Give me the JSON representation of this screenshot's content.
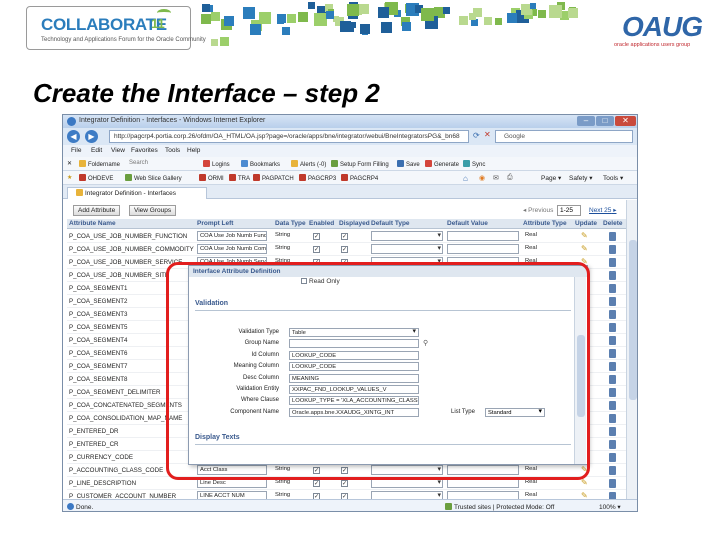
{
  "slide": {
    "collab_logo_word": "COLLABORATE",
    "collab_logo_num": "11",
    "collab_logo_tagline": "Technology and Applications Forum for the Oracle Community",
    "oaug_logo_word": "OAUG",
    "oaug_tagline": "oracle applications users group",
    "title": "Create the Interface – step 2"
  },
  "browser": {
    "window_title": "Integrator Definition - Interfaces - Windows Internet Explorer",
    "url": "http://pagcrp4.portia.corp.26/ofdm/OA_HTML/OA.jsp?page=/oracle/apps/bne/integrator/webui/BneIntegratorsPG&_bn68",
    "search_engine": "Google",
    "menu": [
      "File",
      "Edit",
      "View",
      "Favorites",
      "Tools",
      "Help"
    ],
    "favorites_bar": [
      "Foldername",
      "Search",
      "Logins",
      "Bookmarks",
      "Alerts (-0)",
      "Setup Form Filling",
      "Save",
      "Generate",
      "Sync"
    ],
    "links_bar": [
      "OHDEVE",
      "Web Slice Gallery",
      "ORMI",
      "TRA",
      "PAGPATCH",
      "PAGCRP3",
      "PAGCRP4"
    ],
    "tab_label": "Integrator Definition - Interfaces",
    "status_left": "Done.",
    "status_zone": "Trusted sites | Protected Mode: Off",
    "status_zoom": "100%"
  },
  "page": {
    "buttons": {
      "add_attribute": "Add Attribute",
      "view_groups": "View Groups"
    },
    "pager": {
      "previous": "Previous",
      "range": "1-25",
      "next": "Next 25"
    },
    "columns": [
      "Attribute Name",
      "Prompt Left",
      "Data Type",
      "Enabled",
      "Displayed",
      "Default Type",
      "Default Value",
      "Attribute Type",
      "Update",
      "Delete"
    ],
    "rows": [
      {
        "name": "P_COA_USE_JOB_NUMBER_FUNCTION",
        "prompt": "COA Use Job Numb Func",
        "type": "String",
        "attr_type": "Real"
      },
      {
        "name": "P_COA_USE_JOB_NUMBER_COMMODITY",
        "prompt": "COA Use Job Numb Comm",
        "type": "String",
        "attr_type": "Real"
      },
      {
        "name": "P_COA_USE_JOB_NUMBER_SERVICE",
        "prompt": "COA Use Job Numb Serv",
        "type": "String",
        "attr_type": "Real"
      },
      {
        "name": "P_COA_USE_JOB_NUMBER_SITE",
        "prompt": "",
        "type": "",
        "attr_type": ""
      },
      {
        "name": "P_COA_SEGMENT1",
        "prompt": "",
        "type": "",
        "attr_type": ""
      },
      {
        "name": "P_COA_SEGMENT2",
        "prompt": "",
        "type": "",
        "attr_type": ""
      },
      {
        "name": "P_COA_SEGMENT3",
        "prompt": "",
        "type": "",
        "attr_type": ""
      },
      {
        "name": "P_COA_SEGMENT5",
        "prompt": "",
        "type": "",
        "attr_type": ""
      },
      {
        "name": "P_COA_SEGMENT4",
        "prompt": "",
        "type": "",
        "attr_type": ""
      },
      {
        "name": "P_COA_SEGMENT6",
        "prompt": "",
        "type": "",
        "attr_type": ""
      },
      {
        "name": "P_COA_SEGMENT7",
        "prompt": "",
        "type": "",
        "attr_type": ""
      },
      {
        "name": "P_COA_SEGMENT8",
        "prompt": "",
        "type": "",
        "attr_type": ""
      },
      {
        "name": "P_COA_SEGMENT_DELIMITER",
        "prompt": "",
        "type": "",
        "attr_type": ""
      },
      {
        "name": "P_COA_CONCATENATED_SEGMENTS",
        "prompt": "",
        "type": "",
        "attr_type": ""
      },
      {
        "name": "P_COA_CONSOLIDATION_MAP_NAME",
        "prompt": "",
        "type": "",
        "attr_type": ""
      },
      {
        "name": "P_ENTERED_DR",
        "prompt": "",
        "type": "",
        "attr_type": ""
      },
      {
        "name": "P_ENTERED_CR",
        "prompt": "",
        "type": "",
        "attr_type": ""
      },
      {
        "name": "P_CURRENCY_CODE",
        "prompt": "",
        "type": "",
        "attr_type": ""
      },
      {
        "name": "P_ACCOUNTING_CLASS_CODE",
        "prompt": "Acct Class",
        "type": "String",
        "attr_type": "Real"
      },
      {
        "name": "P_LINE_DESCRIPTION",
        "prompt": "Line Desc",
        "type": "String",
        "attr_type": "Real"
      },
      {
        "name": "P_CUSTOMER_ACCOUNT_NUMBER",
        "prompt": "LINE ACCT NUM",
        "type": "String",
        "attr_type": "Real"
      }
    ]
  },
  "dialog": {
    "title": "Interface Attribute Definition",
    "read_only": "Read Only",
    "validation_header": "Validation",
    "fields": [
      {
        "label": "Validation Type",
        "value": "Table",
        "select": true
      },
      {
        "label": "Group Name",
        "value": "",
        "lookup": true
      },
      {
        "label": "Id Column",
        "value": "LOOKUP_CODE"
      },
      {
        "label": "Meaning Column",
        "value": "LOOKUP_CODE"
      },
      {
        "label": "Desc Column",
        "value": "MEANING"
      },
      {
        "label": "Validation Entity",
        "value": "XXPAC_FND_LOOKUP_VALUES_V"
      },
      {
        "label": "Where Clause",
        "value": "LOOKUP_TYPE = 'XLA_ACCOUNTING_CLASS'"
      },
      {
        "label": "Component Name",
        "value": "Oracle.apps.bne.XXAUDG_XINTG_INT"
      }
    ],
    "list_type_label": "List Type",
    "list_type_value": "Standard",
    "display_texts_header": "Display Texts"
  },
  "colors": {
    "highlight": "#e21e1e",
    "header_blue": "#39598d",
    "collab_blue": "#2b7dbc",
    "collab_green": "#7fb94c",
    "oaug_blue": "#2f66a8"
  }
}
